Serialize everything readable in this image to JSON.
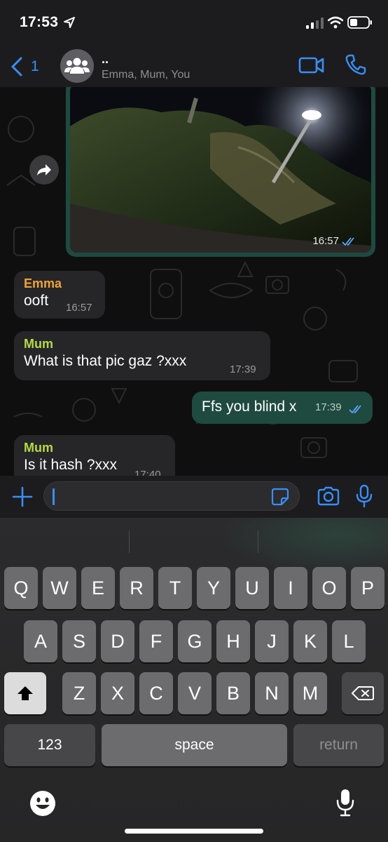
{
  "status_bar": {
    "time": "17:53"
  },
  "header": {
    "back_count": "1",
    "group_name": "..",
    "members": "Emma, Mum, You"
  },
  "messages": [
    {
      "type": "image",
      "direction": "outgoing",
      "time": "16:57",
      "read": true
    },
    {
      "direction": "incoming",
      "sender": "Emma",
      "sender_color": "#f0a238",
      "text": "ooft",
      "time": "16:57"
    },
    {
      "direction": "incoming",
      "sender": "Mum",
      "sender_color": "#b6d94a",
      "text": "What is that pic gaz ?xxx",
      "time": "17:39"
    },
    {
      "direction": "outgoing",
      "text": "Ffs you blind x",
      "time": "17:39",
      "read": true
    },
    {
      "direction": "incoming",
      "sender": "Mum",
      "sender_color": "#b6d94a",
      "text": "Is it hash ?xxx",
      "time": "17:40"
    }
  ],
  "input": {
    "value": ""
  },
  "keyboard": {
    "row1": [
      "Q",
      "W",
      "E",
      "R",
      "T",
      "Y",
      "U",
      "I",
      "O",
      "P"
    ],
    "row2": [
      "A",
      "S",
      "D",
      "F",
      "G",
      "H",
      "J",
      "K",
      "L"
    ],
    "row3": [
      "Z",
      "X",
      "C",
      "V",
      "B",
      "N",
      "M"
    ],
    "numbers_label": "123",
    "space_label": "space",
    "return_label": "return"
  },
  "colors": {
    "accent": "#3a8ef6",
    "outgoing_bubble": "#1f4a3f",
    "incoming_bubble": "#262628",
    "read_ticks": "#5aa8ff"
  }
}
